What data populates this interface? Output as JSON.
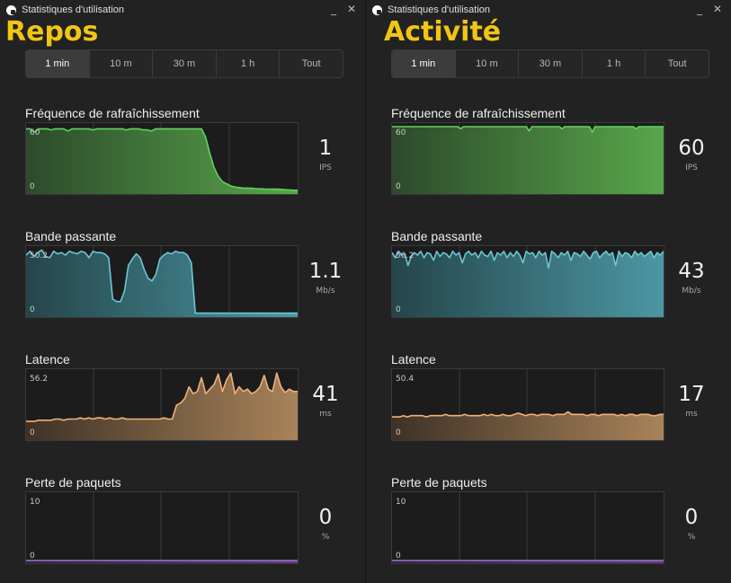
{
  "windows": [
    {
      "side": "left",
      "title": "Statistiques d'utilisation",
      "overlay_label": "Repos",
      "range_tabs": [
        "1 min",
        "10 m",
        "30 m",
        "1 h",
        "Tout"
      ],
      "active_tab": 0,
      "metrics": [
        {
          "label": "Fréquence de rafraîchissement",
          "axis_max": "60",
          "axis_min": "0",
          "value": "1",
          "unit": "IPS",
          "color": "#5fd35f",
          "fill_top": "#58a64a",
          "fill_bottom": "#2d4a2b",
          "scale_max": 60,
          "series": [
            58,
            58,
            55,
            58,
            58,
            58,
            57,
            58,
            58,
            58,
            56,
            58,
            58,
            58,
            58,
            58,
            57,
            58,
            58,
            58,
            58,
            58,
            58,
            58,
            57,
            58,
            58,
            58,
            57,
            57,
            56,
            58,
            58,
            58,
            58,
            58,
            58,
            58,
            58,
            58,
            58,
            58,
            58,
            50,
            35,
            22,
            14,
            9,
            7,
            5,
            4,
            3.5,
            3,
            3,
            2.8,
            2.5,
            2.3,
            2.2,
            2.1,
            2,
            2,
            1.8,
            1.5,
            1.3,
            1,
            1
          ]
        },
        {
          "label": "Bande passante",
          "axis_max": "50.2",
          "axis_min": "0",
          "value": "1.1",
          "unit": "Mb/s",
          "color": "#6cc6d6",
          "fill_top": "#4c97a3",
          "fill_bottom": "#25454b",
          "scale_max": 50.2,
          "series": [
            46,
            49,
            45,
            48,
            50,
            45,
            44,
            49,
            47,
            48,
            46,
            49,
            48,
            47,
            49,
            48,
            44,
            49,
            48,
            48,
            47,
            44,
            12,
            10,
            10,
            18,
            38,
            43,
            47,
            44,
            35,
            28,
            26,
            31,
            43,
            46,
            48,
            47,
            49,
            48,
            48,
            46,
            40,
            1,
            1,
            1,
            1,
            1,
            1,
            1,
            1,
            1,
            1,
            1,
            1,
            1,
            1,
            1,
            1,
            1,
            1,
            1,
            1,
            1,
            1,
            1,
            1,
            1,
            1,
            1
          ]
        },
        {
          "label": "Latence",
          "axis_max": "56.2",
          "axis_min": "0",
          "value": "41",
          "unit": "ms",
          "color": "#f0b27a",
          "fill_top": "#a8835a",
          "fill_bottom": "#3f3226",
          "scale_max": 56.2,
          "series": [
            14,
            14,
            14,
            15,
            15,
            15,
            15,
            16,
            16,
            15,
            16,
            16,
            16,
            17,
            16,
            17,
            16,
            17,
            17,
            16,
            17,
            16,
            16,
            17,
            16,
            16,
            16,
            16,
            16,
            16,
            16,
            16,
            16,
            17,
            16,
            16,
            28,
            30,
            34,
            44,
            38,
            40,
            52,
            38,
            42,
            46,
            55,
            40,
            50,
            56,
            38,
            44,
            40,
            42,
            38,
            40,
            44,
            54,
            42,
            40,
            56,
            44,
            39,
            42,
            40,
            40
          ]
        },
        {
          "label": "Perte de paquets",
          "axis_max": "10",
          "axis_min": "0",
          "value": "0",
          "unit": "%",
          "color": "#a36ee0",
          "fill_top": "#5a3f7a",
          "fill_bottom": "#2c2238",
          "scale_max": 10,
          "series": [
            0,
            0,
            0,
            0,
            0,
            0,
            0,
            0,
            0,
            0,
            0,
            0,
            0,
            0,
            0,
            0,
            0,
            0,
            0,
            0,
            0,
            0,
            0,
            0,
            0,
            0,
            0,
            0,
            0,
            0,
            0,
            0,
            0,
            0,
            0,
            0,
            0,
            0,
            0,
            0,
            0,
            0,
            0,
            0,
            0,
            0,
            0,
            0,
            0,
            0,
            0,
            0,
            0,
            0,
            0,
            0,
            0,
            0,
            0,
            0
          ]
        }
      ]
    },
    {
      "side": "right",
      "title": "Statistiques d'utilisation",
      "overlay_label": "Activité",
      "range_tabs": [
        "1 min",
        "10 m",
        "30 m",
        "1 h",
        "Tout"
      ],
      "active_tab": 0,
      "metrics": [
        {
          "label": "Fréquence de rafraîchissement",
          "axis_max": "60",
          "axis_min": "0",
          "value": "60",
          "unit": "IPS",
          "color": "#5fd35f",
          "fill_top": "#58a64a",
          "fill_bottom": "#2d4a2b",
          "scale_max": 60,
          "series": [
            60,
            60,
            60,
            60,
            60,
            60,
            60,
            60,
            60,
            60,
            60,
            60,
            60,
            60,
            60,
            60,
            60,
            60,
            60,
            60,
            60,
            60,
            60,
            60,
            60,
            58,
            60,
            60,
            60,
            60,
            60,
            60,
            60,
            60,
            60,
            60,
            60,
            60,
            60,
            60,
            60,
            60,
            60,
            60,
            60,
            60,
            60,
            60,
            60,
            60,
            56,
            60,
            60,
            60,
            60,
            60,
            60,
            60,
            60,
            60,
            60,
            60,
            58,
            60,
            60,
            60,
            60,
            60,
            60,
            60,
            60,
            60,
            60,
            55,
            60,
            60,
            60,
            60,
            60,
            60,
            60,
            60,
            60,
            60,
            60,
            60,
            60,
            60,
            60,
            58,
            60,
            60,
            60,
            60,
            60,
            60,
            60,
            60,
            60,
            60
          ]
        },
        {
          "label": "Bande passante",
          "axis_max": "50.2",
          "axis_min": "0",
          "value": "43",
          "unit": "Mb/s",
          "color": "#6cc6d6",
          "fill_top": "#4c97a3",
          "fill_bottom": "#25454b",
          "scale_max": 50.2,
          "series": [
            48,
            44,
            49,
            46,
            47,
            38,
            45,
            48,
            46,
            49,
            44,
            48,
            47,
            42,
            49,
            45,
            48,
            47,
            44,
            49,
            46,
            48,
            40,
            47,
            49,
            46,
            48,
            44,
            49,
            46,
            45,
            49,
            42,
            48,
            46,
            49,
            44,
            48,
            45,
            49,
            46,
            40,
            49,
            47,
            48,
            44,
            49,
            46,
            48,
            36,
            49,
            47,
            44,
            48,
            46,
            49,
            42,
            48,
            47,
            45,
            49,
            46,
            43,
            48,
            49,
            44,
            47,
            49,
            46,
            48,
            38,
            49,
            45,
            48,
            47,
            44,
            49,
            46,
            48,
            45,
            47,
            49,
            44,
            48,
            46,
            49
          ]
        },
        {
          "label": "Latence",
          "axis_max": "50.4",
          "axis_min": "0",
          "value": "17",
          "unit": "ms",
          "color": "#f0b27a",
          "fill_top": "#a8835a",
          "fill_bottom": "#3f3226",
          "scale_max": 50.4,
          "series": [
            16,
            16,
            16,
            17,
            16,
            17,
            17,
            17,
            17,
            16,
            17,
            17,
            17,
            17,
            18,
            17,
            17,
            17,
            17,
            18,
            17,
            17,
            17,
            17,
            18,
            17,
            18,
            17,
            17,
            18,
            17,
            17,
            18,
            19,
            18,
            17,
            18,
            18,
            17,
            18,
            18,
            18,
            17,
            18,
            18,
            18,
            20,
            18,
            18,
            18,
            18,
            17,
            18,
            18,
            17,
            18,
            18,
            18,
            18,
            17,
            18,
            17,
            18,
            18,
            17,
            18,
            18,
            18,
            17,
            17,
            18,
            18
          ]
        },
        {
          "label": "Perte de paquets",
          "axis_max": "10",
          "axis_min": "0",
          "value": "0",
          "unit": "%",
          "color": "#a36ee0",
          "fill_top": "#5a3f7a",
          "fill_bottom": "#2c2238",
          "scale_max": 10,
          "series": [
            0,
            0,
            0,
            0,
            0,
            0,
            0,
            0,
            0,
            0,
            0,
            0,
            0,
            0,
            0,
            0,
            0,
            0,
            0,
            0,
            0,
            0,
            0,
            0,
            0,
            0,
            0,
            0,
            0,
            0,
            0,
            0,
            0,
            0,
            0,
            0,
            0,
            0,
            0,
            0,
            0,
            0,
            0,
            0,
            0,
            0,
            0,
            0,
            0,
            0,
            0,
            0,
            0,
            0,
            0,
            0,
            0,
            0,
            0,
            0
          ]
        }
      ]
    }
  ]
}
